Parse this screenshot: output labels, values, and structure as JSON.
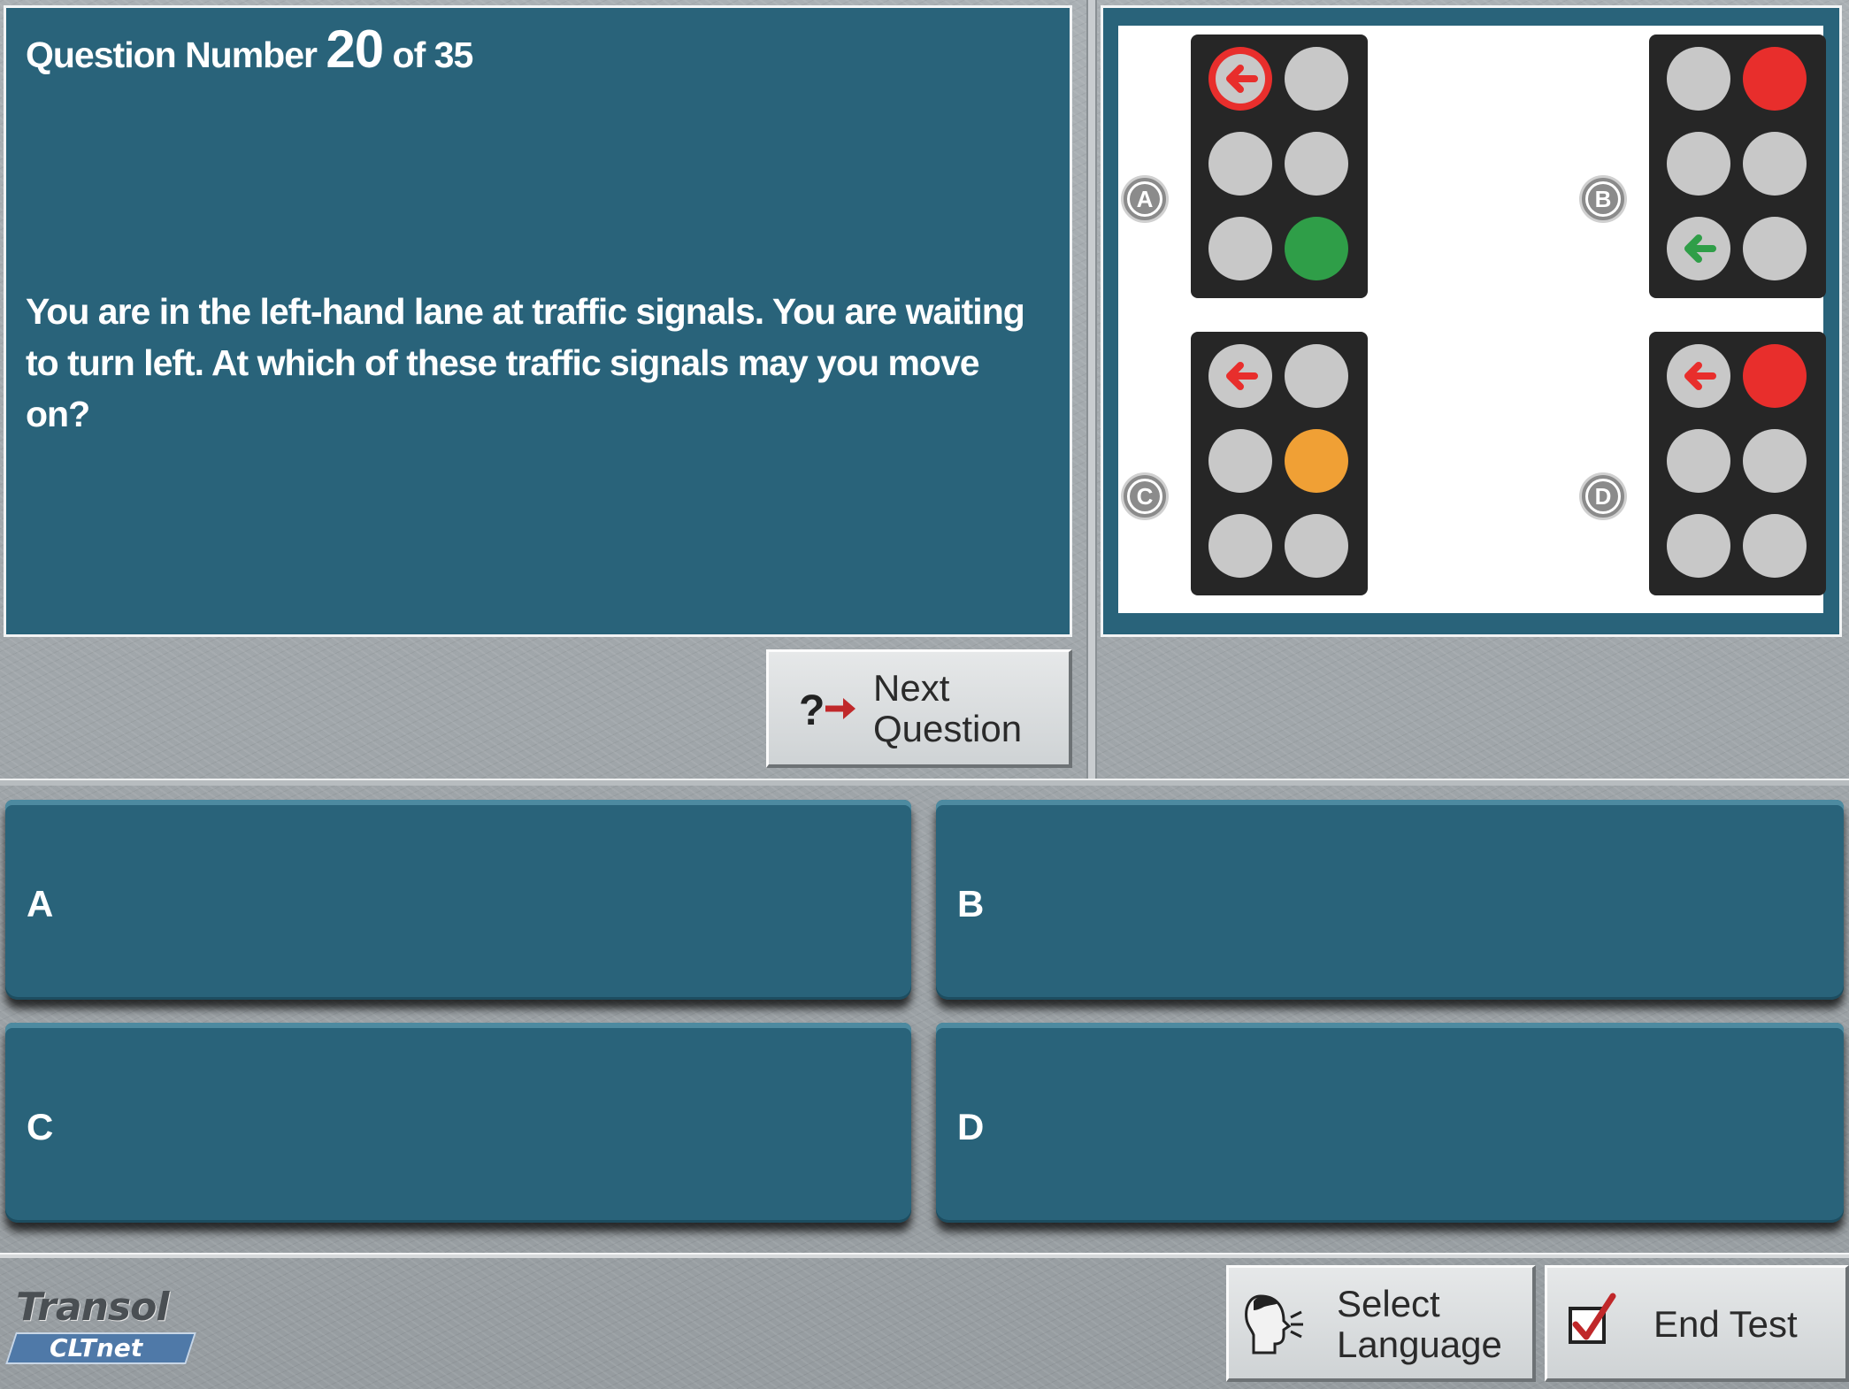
{
  "question": {
    "label": "Question Number",
    "number": "20",
    "of_total": "of 35",
    "text": "You are in the left-hand lane at traffic signals. You are waiting to turn left. At which of these traffic signals may you move on?"
  },
  "image": {
    "options": [
      {
        "label": "A",
        "lamps": [
          "red-left-arrow",
          "off",
          "off",
          "off",
          "off",
          "green"
        ]
      },
      {
        "label": "B",
        "lamps": [
          "off",
          "red",
          "off",
          "off",
          "green-left-arrow",
          "off"
        ]
      },
      {
        "label": "C",
        "lamps": [
          "red-left-arrow",
          "off",
          "off",
          "amber",
          "off",
          "off"
        ]
      },
      {
        "label": "D",
        "lamps": [
          "red-left-arrow",
          "red",
          "off",
          "off",
          "off",
          "off"
        ]
      }
    ],
    "colors": {
      "red": "#e82e2c",
      "green": "#2f9e48",
      "amber": "#f0a035",
      "off": "#c8c8c8"
    }
  },
  "buttons": {
    "next_line1": "Next",
    "next_line2": "Question",
    "lang_line1": "Select",
    "lang_line2": "Language",
    "end": "End Test"
  },
  "answers": {
    "a": "A",
    "b": "B",
    "c": "C",
    "d": "D"
  },
  "logo": {
    "top": "Transol",
    "bottom": "CLTnet"
  },
  "theme": {
    "panel": "#29637a",
    "background": "#9ea4a8"
  }
}
